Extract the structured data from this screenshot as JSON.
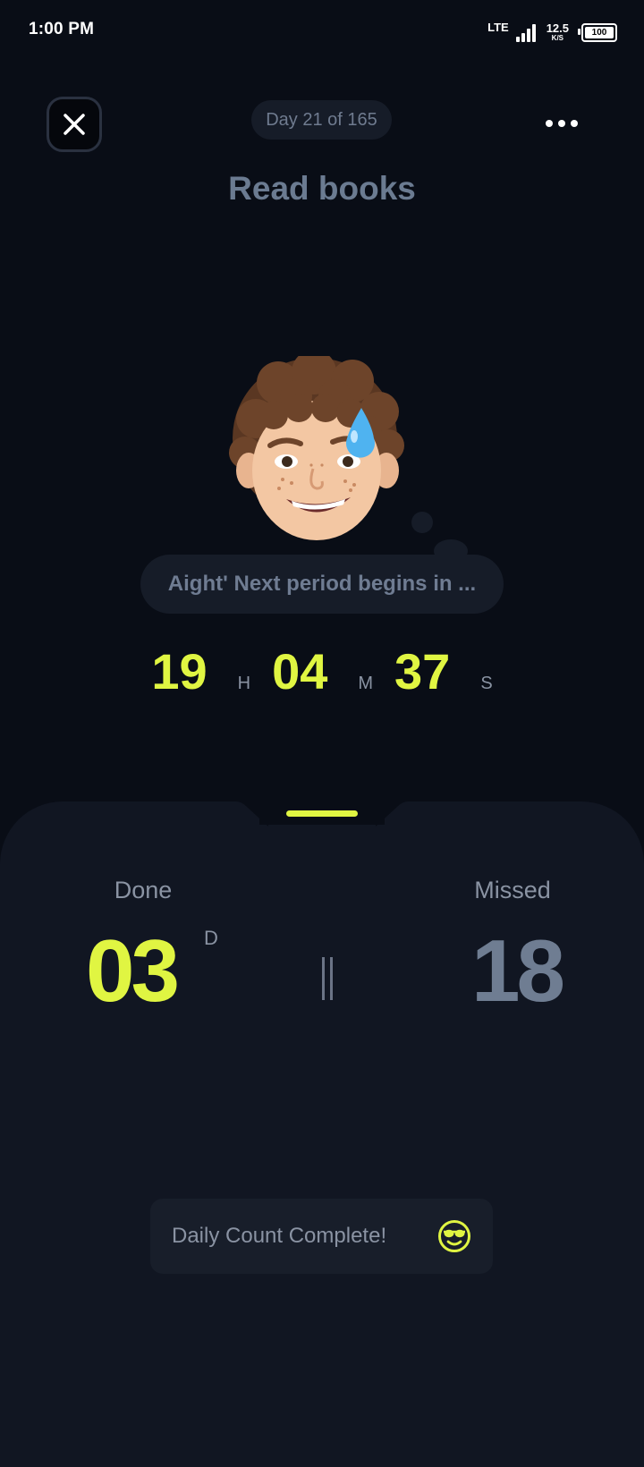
{
  "status_bar": {
    "time": "1:00 PM",
    "network": "LTE",
    "speed_value": "12.5",
    "speed_unit": "K/S",
    "battery": "100"
  },
  "header": {
    "day_label": "Day 21 of 165",
    "title": "Read books",
    "close_icon": "close-icon",
    "more_icon": "more-horizontal-icon"
  },
  "avatar": {
    "icon": "memoji-sweat-smile-icon"
  },
  "message": "Aight' Next period begins in ...",
  "timer": {
    "hours": "19",
    "hours_unit": "H",
    "minutes": "04",
    "minutes_unit": "M",
    "seconds": "37",
    "seconds_unit": "S"
  },
  "stats": {
    "done_label": "Done",
    "done_value": "03",
    "done_unit": "D",
    "separator": "‖",
    "missed_label": "Missed",
    "missed_value": "18"
  },
  "completion": {
    "text": "Daily Count Complete!",
    "icon": "sunglasses-smiley-icon"
  },
  "colors": {
    "background": "#090d16",
    "sheet": "#111622",
    "accent": "#e0f542",
    "muted": "#6f7b8f"
  }
}
